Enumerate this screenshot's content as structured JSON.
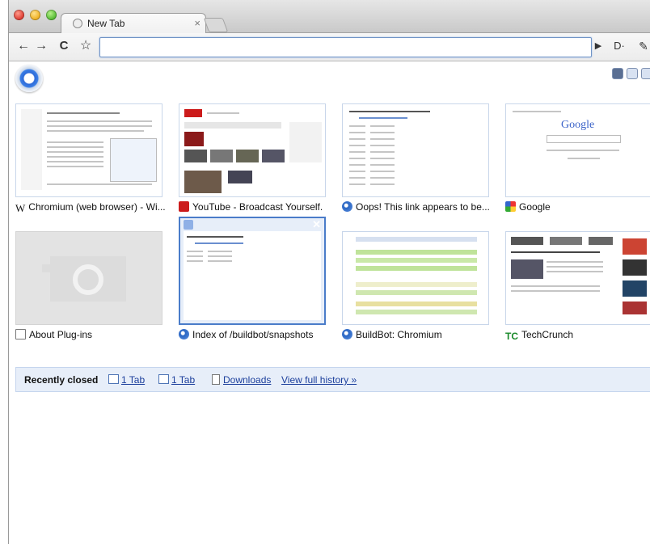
{
  "window": {
    "tab": {
      "title": "New Tab",
      "close_glyph": "×",
      "favicon": "page-globe-icon"
    }
  },
  "toolbar": {
    "back": "←",
    "forward": "→",
    "reload": "C",
    "star": "☆",
    "omnibox_value": "",
    "go": "▶",
    "page_menu": "D·",
    "wrench": "✎"
  },
  "thumbnails": [
    {
      "title": "Chromium (web browser) - Wi...",
      "favicon": "wikipedia-icon",
      "favicon_text": "W"
    },
    {
      "title": "YouTube - Broadcast Yourself.",
      "favicon": "youtube-icon",
      "favicon_text": ""
    },
    {
      "title": "Oops! This link appears to be...",
      "favicon": "globe-icon",
      "favicon_text": ""
    },
    {
      "title": "Google",
      "favicon": "google-icon",
      "favicon_text": ""
    },
    {
      "title": "About Plug-ins",
      "favicon": "page-icon",
      "favicon_text": ""
    },
    {
      "title": "Index of /buildbot/snapshots",
      "favicon": "globe-icon",
      "favicon_text": ""
    },
    {
      "title": "BuildBot: Chromium",
      "favicon": "globe-icon",
      "favicon_text": ""
    },
    {
      "title": "TechCrunch",
      "favicon": "techcrunch-icon",
      "favicon_text": "TC"
    }
  ],
  "recently_closed": {
    "title": "Recently closed",
    "items": [
      "1 Tab",
      "1 Tab",
      "Downloads"
    ],
    "history_link": "View full history »"
  },
  "colors": {
    "accent": "#4a7cc9",
    "link": "#1c3f9c",
    "bar_bg": "#e7eef9"
  }
}
